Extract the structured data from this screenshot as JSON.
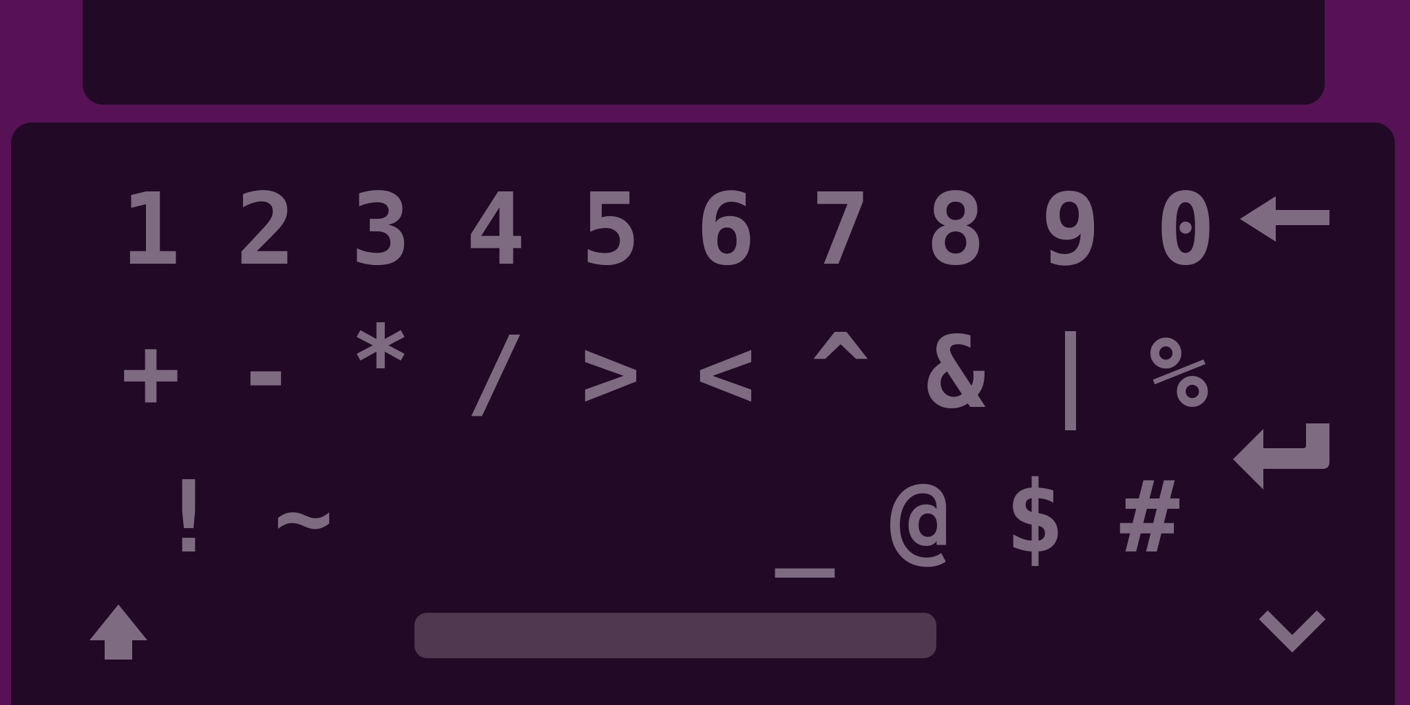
{
  "input": {
    "value": ""
  },
  "keyboard": {
    "row1": [
      "1",
      "2",
      "3",
      "4",
      "5",
      "6",
      "7",
      "8",
      "9",
      "0"
    ],
    "row2": [
      "+",
      "-",
      "*",
      "/",
      ">",
      "<",
      "^",
      "&",
      "|",
      "%"
    ],
    "row3": [
      "!",
      "~",
      "_",
      "@",
      "$",
      "#"
    ]
  },
  "icons": {
    "backspace": "backspace-arrow-icon",
    "enter": "enter-return-icon",
    "shift": "shift-up-arrow-icon",
    "hide": "chevron-down-icon",
    "space": "space-bar"
  },
  "colors": {
    "background": "#561255",
    "panel": "#220926",
    "key": "#7e6b82",
    "space_bar": "#4f3850"
  }
}
